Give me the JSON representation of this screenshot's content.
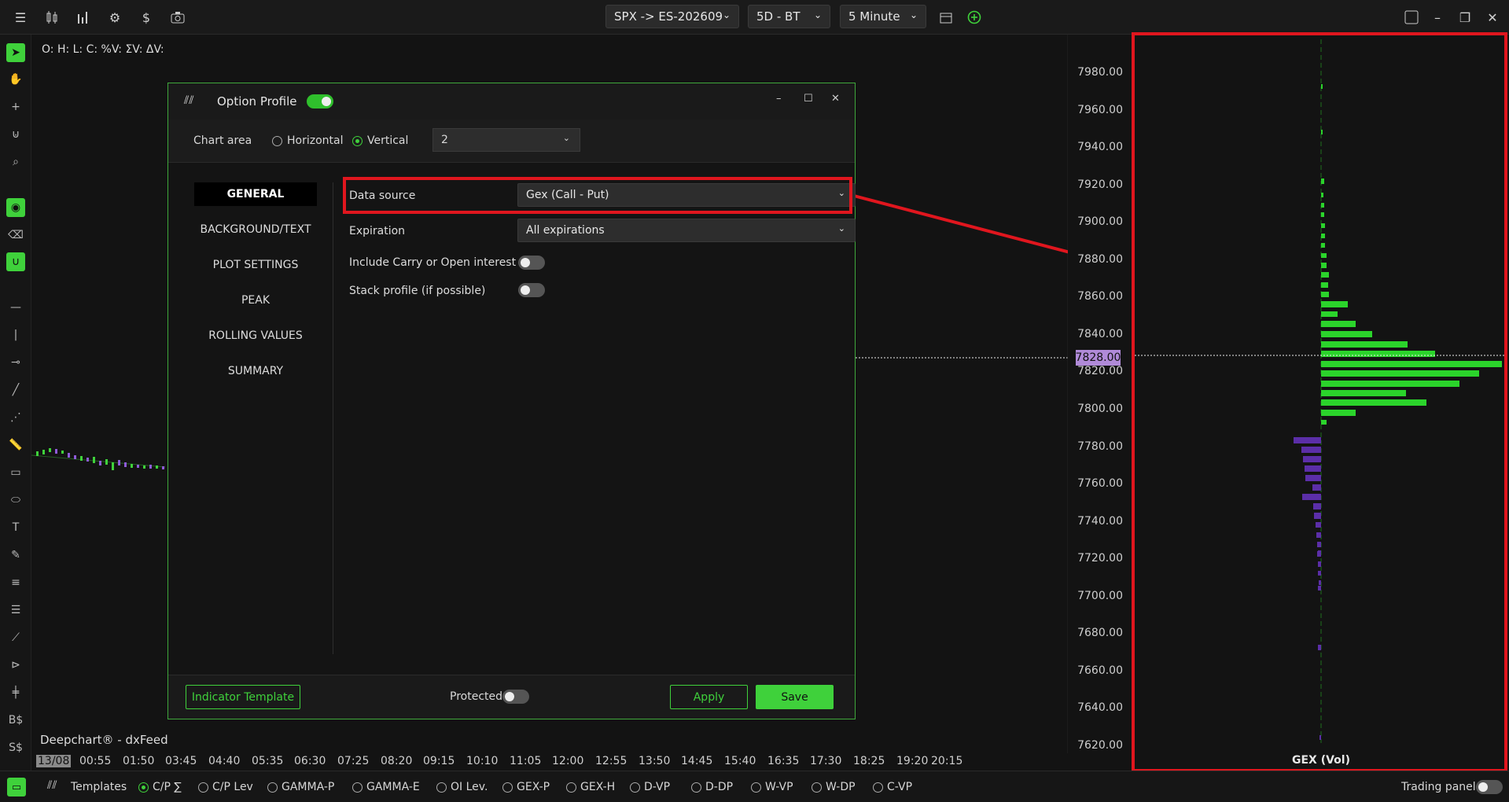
{
  "topbar": {
    "icons": [
      "menu-icon",
      "candles-icon",
      "bars-chart-icon",
      "gear-icon",
      "dollar-icon",
      "camera-icon"
    ],
    "symbol": "SPX -> ES-202609",
    "period": "5D - BT",
    "interval": "5 Minute"
  },
  "ohlc_line": "O: H: L: C: %V: ΣV: ΔV:",
  "price_axis": {
    "labels": [
      "7980.00",
      "7960.00",
      "7940.00",
      "7920.00",
      "7900.00",
      "7880.00",
      "7860.00",
      "7840.00",
      "7820.00",
      "7800.00",
      "7780.00",
      "7760.00",
      "7740.00",
      "7720.00",
      "7700.00",
      "7680.00",
      "7660.00",
      "7640.00",
      "7620.00"
    ],
    "current": "7828.00"
  },
  "time_axis": [
    "13/08",
    "00:55",
    "01:50",
    "03:45",
    "04:40",
    "05:35",
    "06:30",
    "07:25",
    "08:20",
    "09:15",
    "10:10",
    "11:05",
    "12:00",
    "12:55",
    "13:50",
    "14:45",
    "15:40",
    "16:35",
    "17:30",
    "18:25",
    "19:20",
    "20:15"
  ],
  "brand": "Deepchart® - dxFeed",
  "gex_label": "GEX (Vol)",
  "dialog": {
    "title": "Option Profile",
    "chart_area_label": "Chart area",
    "orientation_options": [
      "Horizontal",
      "Vertical"
    ],
    "orientation_selected": "Vertical",
    "area_value": "2",
    "nav": [
      "GENERAL",
      "BACKGROUND/TEXT",
      "PLOT SETTINGS",
      "PEAK",
      "ROLLING VALUES",
      "SUMMARY"
    ],
    "data_source_label": "Data source",
    "data_source_value": "Gex (Call - Put)",
    "expiration_label": "Expiration",
    "expiration_value": "All expirations",
    "carry_label": "Include Carry or Open interest",
    "stack_label": "Stack profile (if possible)",
    "template_btn": "Indicator Template",
    "protected_label": "Protected",
    "apply_btn": "Apply",
    "save_btn": "Save"
  },
  "bottombar": {
    "templates_label": "Templates",
    "items": [
      "C/P ∑",
      "C/P Lev",
      "GAMMA-P",
      "GAMMA-E",
      "OI Lev.",
      "GEX-P",
      "GEX-H",
      "D-VP",
      "D-DP",
      "W-VP",
      "W-DP",
      "C-VP"
    ],
    "selected": "C/P ∑",
    "trading_panel": "Trading panel"
  },
  "colors": {
    "accent": "#3fd13b",
    "alert": "#e0161e",
    "put": "#5b2ea8",
    "current_price": "#b08ad8"
  }
}
